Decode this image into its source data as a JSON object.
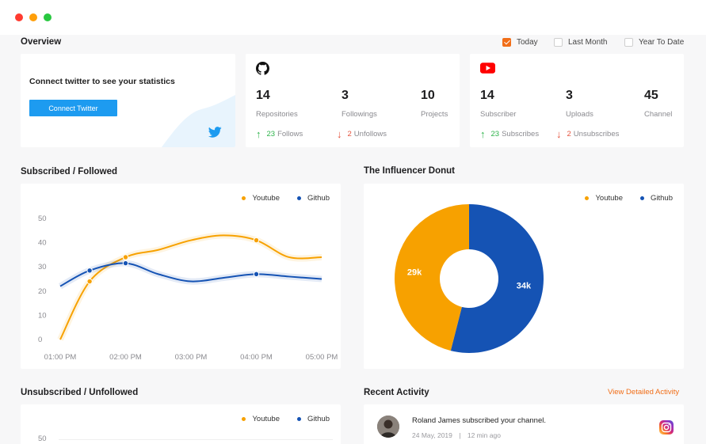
{
  "window": {
    "controls": [
      "close",
      "minimize",
      "maximize"
    ]
  },
  "overview": {
    "title": "Overview",
    "filters": [
      {
        "label": "Today",
        "checked": true
      },
      {
        "label": "Last Month",
        "checked": false
      },
      {
        "label": "Year To Date",
        "checked": false
      }
    ]
  },
  "twitter_card": {
    "title": "Connect twitter to see your statistics",
    "button": "Connect Twitter",
    "icon": "twitter-icon"
  },
  "github_card": {
    "icon": "github-icon",
    "stats": [
      {
        "value": "14",
        "label": "Repositories"
      },
      {
        "value": "3",
        "label": "Followings"
      },
      {
        "value": "10",
        "label": "Projects"
      }
    ],
    "follows": {
      "count": "23",
      "label": "Follows"
    },
    "unfollows": {
      "count": "2",
      "label": "Unfollows"
    }
  },
  "youtube_card": {
    "icon": "youtube-icon",
    "stats": [
      {
        "value": "14",
        "label": "Subscriber"
      },
      {
        "value": "3",
        "label": "Uploads"
      },
      {
        "value": "45",
        "label": "Channel"
      }
    ],
    "subscribes": {
      "count": "23",
      "label": "Subscribes"
    },
    "unsubscribes": {
      "count": "2",
      "label": "Unsubscribes"
    }
  },
  "colors": {
    "youtube": "#f7a100",
    "github": "#1553b4",
    "accent": "#f16e18",
    "twitter": "#1d9bf0"
  },
  "subscribed_section": {
    "title": "Subscribed / Followed"
  },
  "donut_section": {
    "title": "The Influencer Donut"
  },
  "unsubscribed_section": {
    "title": "Unsubscribed / Unfollowed"
  },
  "activity_section": {
    "title": "Recent Activity",
    "link": "View Detailed Activity",
    "items": [
      {
        "text": "Roland James subscribed your channel.",
        "date": "24 May, 2019",
        "separator": "|",
        "time": "12 min ago",
        "icon": "instagram-icon"
      }
    ]
  },
  "chart_data": [
    {
      "type": "line",
      "title": "Subscribed / Followed",
      "x": [
        "01:00 PM",
        "02:00 PM",
        "03:00 PM",
        "04:00 PM",
        "05:00 PM"
      ],
      "ylim": [
        0,
        50
      ],
      "yticks": [
        0,
        10,
        20,
        30,
        40,
        50
      ],
      "legend": "top-right",
      "grid": false,
      "series": [
        {
          "name": "Youtube",
          "points": [
            [
              0.0,
              0
            ],
            [
              0.45,
              24
            ],
            [
              1.0,
              34
            ],
            [
              1.5,
              37
            ],
            [
              2.0,
              41
            ],
            [
              2.5,
              43
            ],
            [
              3.0,
              41
            ],
            [
              3.5,
              34
            ],
            [
              4.0,
              34
            ]
          ],
          "markers": [
            1,
            2,
            6
          ]
        },
        {
          "name": "Github",
          "points": [
            [
              0.0,
              22
            ],
            [
              0.45,
              28.5
            ],
            [
              1.0,
              31.5
            ],
            [
              1.5,
              27
            ],
            [
              2.0,
              24
            ],
            [
              2.5,
              25.5
            ],
            [
              3.0,
              27
            ],
            [
              3.5,
              26
            ],
            [
              4.0,
              25
            ]
          ],
          "markers": [
            1,
            2,
            6
          ]
        }
      ]
    },
    {
      "type": "pie",
      "title": "The Influencer Donut",
      "legend": "top-right",
      "labels": [
        "Youtube",
        "Github"
      ],
      "values": [
        29,
        34
      ],
      "value_labels": [
        "29k",
        "34k"
      ]
    },
    {
      "type": "line",
      "title": "Unsubscribed / Unfollowed",
      "legend": "top-right",
      "yticks_visible": [
        50
      ],
      "series": [
        {
          "name": "Youtube"
        },
        {
          "name": "Github"
        }
      ]
    }
  ]
}
